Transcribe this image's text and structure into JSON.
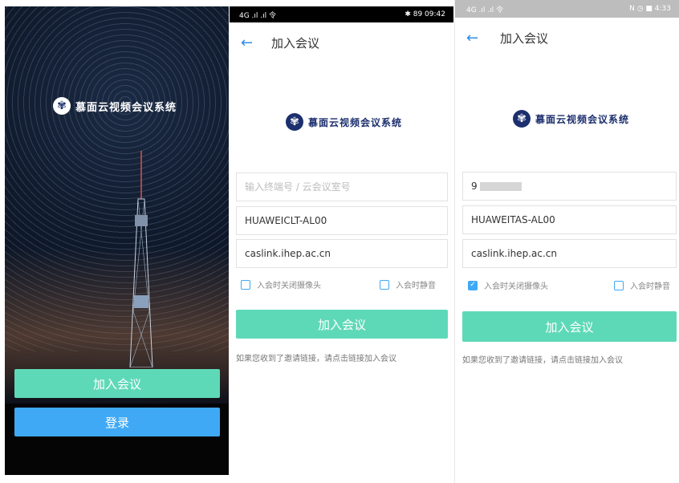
{
  "splash": {
    "logo_text": "慕面云视频会议系统",
    "logo_icon": "academy-emblem-icon",
    "join_label": "加入会议",
    "login_label": "登录",
    "colors": {
      "join": "#5ed9b8",
      "login": "#3fa9f5"
    }
  },
  "screen2": {
    "status_left": "4G .ıl .ıl 令",
    "status_right": "✱ 89 09:42",
    "title": "加入会议",
    "logo_text": "慕面云视频会议系统",
    "meeting_placeholder": "输入终端号 / 云会议室号",
    "meeting_value": "",
    "name_value": "HUAWEICLT-AL00",
    "server_value": "caslink.ihep.ac.cn",
    "camera_off_label": "入会时关闭摄像头",
    "camera_off_checked": false,
    "mute_label": "入会时静音",
    "mute_checked": false,
    "join_label": "加入会议",
    "hint": "如果您收到了邀请链接，请点击链接加入会议"
  },
  "screen3": {
    "status_left": "4G .ıl .ıl 令",
    "status_right": "N ◷ ■ 4:33",
    "title": "加入会议",
    "logo_text": "慕面云视频会议系统",
    "meeting_value": "9",
    "name_value": "HUAWEITAS-AL00",
    "server_value": "caslink.ihep.ac.cn",
    "camera_off_label": "入会时关闭摄像头",
    "camera_off_checked": true,
    "mute_label": "入会时静音",
    "mute_checked": false,
    "join_label": "加入会议",
    "hint": "如果您收到了邀请链接，请点击链接加入会议"
  }
}
